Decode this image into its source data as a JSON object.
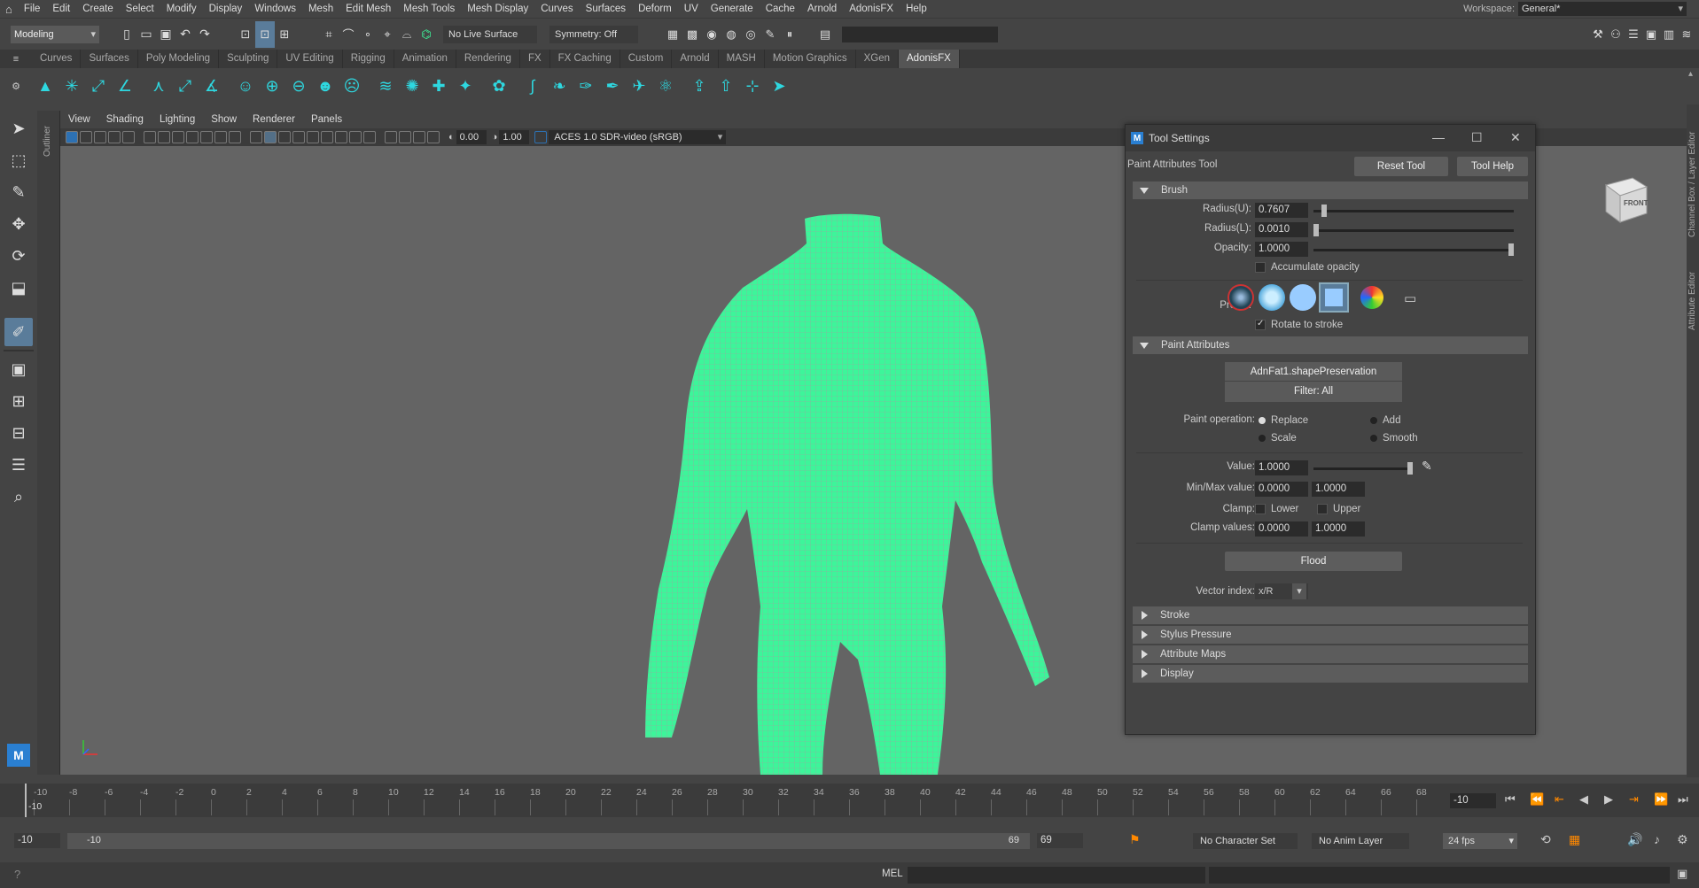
{
  "menubar": {
    "items": [
      "File",
      "Edit",
      "Create",
      "Select",
      "Modify",
      "Display",
      "Windows",
      "Mesh",
      "Edit Mesh",
      "Mesh Tools",
      "Mesh Display",
      "Curves",
      "Surfaces",
      "Deform",
      "UV",
      "Generate",
      "Cache",
      "Arnold",
      "AdonisFX",
      "Help"
    ],
    "workspace_label": "Workspace:",
    "workspace_value": "General*"
  },
  "statusline": {
    "mode": "Modeling",
    "live_surface": "No Live Surface",
    "symmetry": "Symmetry: Off"
  },
  "shelf_tabs": [
    "Curves",
    "Surfaces",
    "Poly Modeling",
    "Sculpting",
    "UV Editing",
    "Rigging",
    "Animation",
    "Rendering",
    "FX",
    "FX Caching",
    "Custom",
    "Arnold",
    "MASH",
    "Motion Graphics",
    "XGen",
    "AdonisFX"
  ],
  "shelf_active": "AdonisFX",
  "outliner_label": "Outliner",
  "viewport": {
    "menu": [
      "View",
      "Shading",
      "Lighting",
      "Show",
      "Renderer",
      "Panels"
    ],
    "exposure": "0.00",
    "gamma": "1.00",
    "colorspace": "ACES 1.0 SDR-video (sRGB)",
    "cube_label": "FRONT",
    "mesh_color": "#3df59a",
    "background_color": "#646464"
  },
  "right_rail": {
    "channel_box": "Channel Box / Layer Editor",
    "attribute_editor": "Attribute Editor"
  },
  "tool_settings": {
    "title": "Tool Settings",
    "tool_name": "Paint Attributes Tool",
    "reset_button": "Reset Tool",
    "help_button": "Tool Help",
    "brush": {
      "header": "Brush",
      "radius_u_label": "Radius(U):",
      "radius_u": "0.7607",
      "radius_u_fraction": 0.04,
      "radius_l_label": "Radius(L):",
      "radius_l": "0.0010",
      "radius_l_fraction": 0.0,
      "opacity_label": "Opacity:",
      "opacity": "1.0000",
      "opacity_fraction": 1.0,
      "accumulate_label": "Accumulate opacity",
      "profile_label": "Profile:",
      "rotate_label": "Rotate to stroke"
    },
    "paint_attributes": {
      "header": "Paint Attributes",
      "attribute": "AdnFat1.shapePreservation",
      "filter": "Filter: All",
      "operation_label": "Paint operation:",
      "op_replace": "Replace",
      "op_add": "Add",
      "op_scale": "Scale",
      "op_smooth": "Smooth",
      "selected_operation": "Replace",
      "value_label": "Value:",
      "value": "1.0000",
      "value_fraction": 1.0,
      "minmax_label": "Min/Max value:",
      "min_value": "0.0000",
      "max_value": "1.0000",
      "clamp_label": "Clamp:",
      "clamp_lower": "Lower",
      "clamp_upper": "Upper",
      "clamp_values_label": "Clamp values:",
      "clamp_min": "0.0000",
      "clamp_max": "1.0000",
      "flood_button": "Flood",
      "vector_index_label": "Vector index:",
      "vector_index": "x/R"
    },
    "collapsed_sections": [
      "Stroke",
      "Stylus Pressure",
      "Attribute Maps",
      "Display"
    ]
  },
  "timeline": {
    "ticks": [
      "-10",
      "-8",
      "-6",
      "-4",
      "-2",
      "0",
      "2",
      "4",
      "6",
      "8",
      "10",
      "12",
      "14",
      "16",
      "18",
      "20",
      "22",
      "24",
      "26",
      "28",
      "30",
      "32",
      "34",
      "36",
      "38",
      "40",
      "42",
      "44",
      "46",
      "48",
      "50",
      "52",
      "54",
      "56",
      "58",
      "60",
      "62",
      "64",
      "66",
      "68"
    ],
    "current_frame": "-10",
    "current_frame_field": "-10"
  },
  "range": {
    "start": "-10",
    "inner_start": "-10",
    "inner_end": "69",
    "end": "69",
    "character_set": "No Character Set",
    "anim_layer": "No Anim Layer",
    "fps": "24 fps"
  },
  "command_line": {
    "language": "MEL"
  }
}
